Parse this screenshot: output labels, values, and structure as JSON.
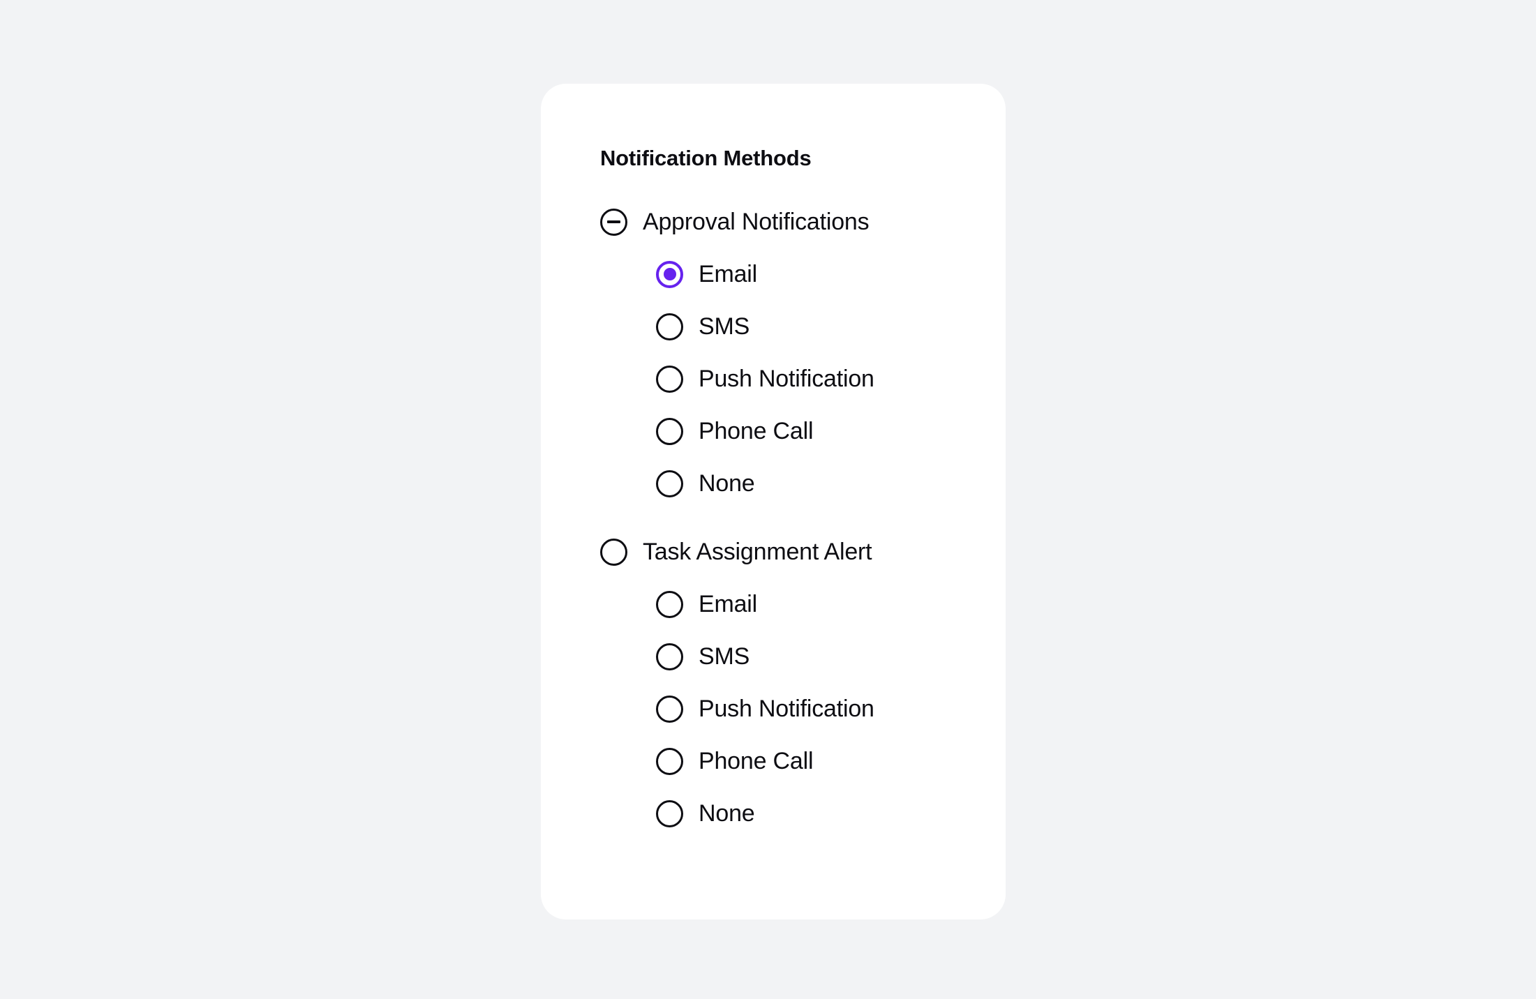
{
  "page": {
    "background_color": "#F2F3F5"
  },
  "card": {
    "background_color": "#FFFFFF",
    "title": "Notification Methods"
  },
  "accent_color": "#6622EE",
  "text_color": "#0D0D12",
  "groups": [
    {
      "id": "approval-notifications",
      "label": "Approval Notifications",
      "state": "indeterminate",
      "indicator_icon": "minus-circle-icon",
      "options": [
        {
          "label": "Email",
          "selected": true
        },
        {
          "label": "SMS",
          "selected": false
        },
        {
          "label": "Push Notification",
          "selected": false
        },
        {
          "label": "Phone Call",
          "selected": false
        },
        {
          "label": "None",
          "selected": false
        }
      ]
    },
    {
      "id": "task-assignment-alert",
      "label": "Task Assignment Alert",
      "state": "unselected",
      "indicator_icon": "radio-unchecked-icon",
      "options": [
        {
          "label": "Email",
          "selected": false
        },
        {
          "label": "SMS",
          "selected": false
        },
        {
          "label": "Push Notification",
          "selected": false
        },
        {
          "label": "Phone Call",
          "selected": false
        },
        {
          "label": "None",
          "selected": false
        }
      ]
    }
  ]
}
